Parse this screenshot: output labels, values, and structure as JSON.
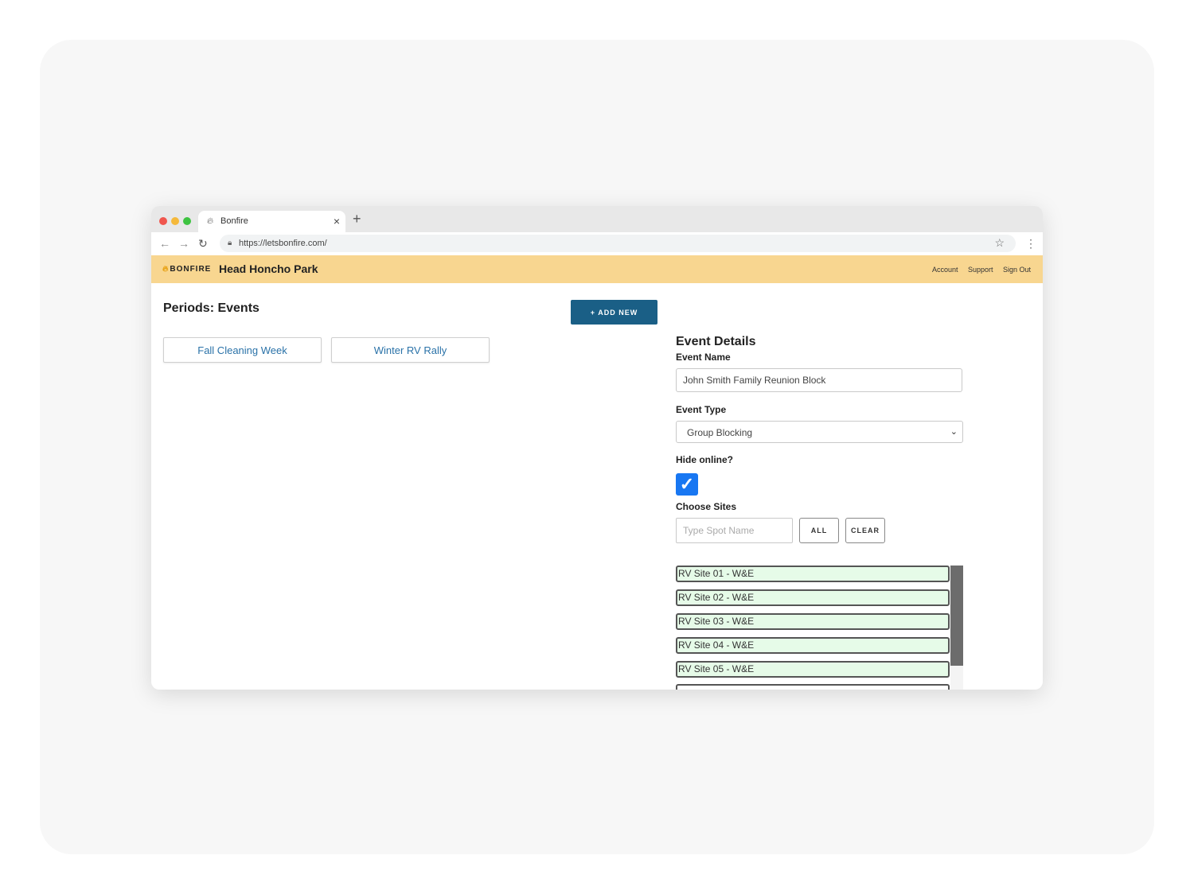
{
  "browser": {
    "tab_title": "Bonfire",
    "tab_close": "×",
    "new_tab": "+",
    "url": "https://letsbonfire.com/"
  },
  "app": {
    "logo_text": "BONFIRE",
    "park_name": "Head Honcho Park",
    "nav": [
      "Account",
      "Support",
      "Sign Out"
    ],
    "brand_color": "#f8d690",
    "accent_color": "#1a5f86"
  },
  "periods": {
    "title": "Periods: Events",
    "add_new_label": "+ ADD NEW",
    "events": [
      "Fall Cleaning Week",
      "Winter RV Rally"
    ]
  },
  "details": {
    "title": "Event Details",
    "event_name_label": "Event Name",
    "event_name_value": "John Smith Family Reunion Block",
    "event_type_label": "Event Type",
    "event_type_value": "Group Blocking",
    "hide_online_label": "Hide online?",
    "hide_online_checked": true,
    "choose_sites_label": "Choose Sites",
    "spot_placeholder": "Type Spot Name",
    "all_label": "ALL",
    "clear_label": "CLEAR",
    "sites": [
      "RV Site 01 - W&E",
      "RV Site 02 - W&E",
      "RV Site 03 - W&E",
      "RV Site 04 - W&E",
      "RV Site 05 - W&E",
      ""
    ]
  }
}
